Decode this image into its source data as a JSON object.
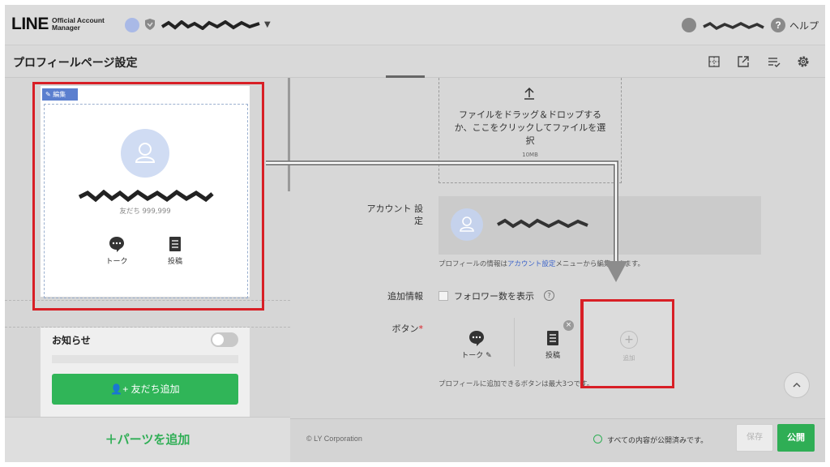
{
  "header": {
    "logo_text": "LINE",
    "logo_sub_1": "Official Account",
    "logo_sub_2": "Manager",
    "help_label": "ヘルプ",
    "help_icon": "?"
  },
  "subheader": {
    "title": "プロフィールページ設定",
    "icons": [
      "layout-icon",
      "external-link-icon",
      "list-check-icon",
      "gear-icon"
    ]
  },
  "preview": {
    "edit_tag": "編集",
    "friends_count": "友だち 999,999",
    "actions": [
      {
        "label": "トーク",
        "icon": "chat-bubble-icon"
      },
      {
        "label": "投稿",
        "icon": "post-icon"
      }
    ],
    "notice_label": "お知らせ",
    "add_friend_button": "友だち追加",
    "add_parts_button": "＋パーツを追加"
  },
  "form": {
    "upload_text": "ファイルをドラッグ＆ドロップするか、ここをクリックしてファイルを選択",
    "upload_size": "10MB",
    "account_label_1": "アカウント 設",
    "account_label_2": "定",
    "account_hint_1": "プロフィールの情報は",
    "account_hint_link": "アカウント設定",
    "account_hint_2": "メニューから編集できます。",
    "extra_label": "追加情報",
    "show_followers_label": "フォロワー数を表示",
    "show_followers_checked": false,
    "help_icon": "?",
    "buttons_label": "ボタン",
    "required_mark": "*",
    "buttons": [
      {
        "label": "トーク",
        "icon": "chat-bubble-icon"
      },
      {
        "label": "投稿",
        "icon": "post-icon"
      }
    ],
    "add_label": "追加",
    "add_plus": "+",
    "remove_symbol": "×",
    "buttons_hint": "プロフィールに追加できるボタンは最大3つです。"
  },
  "footer": {
    "copyright": "© LY Corporation",
    "status_text": "すべての内容が公開済みです。",
    "save_button": "保存",
    "publish_button": "公開"
  },
  "colors": {
    "line_green": "#2fae55",
    "highlight_red": "#d81f26",
    "edit_blue": "#5b7fcf",
    "link_blue": "#3b63c9"
  }
}
